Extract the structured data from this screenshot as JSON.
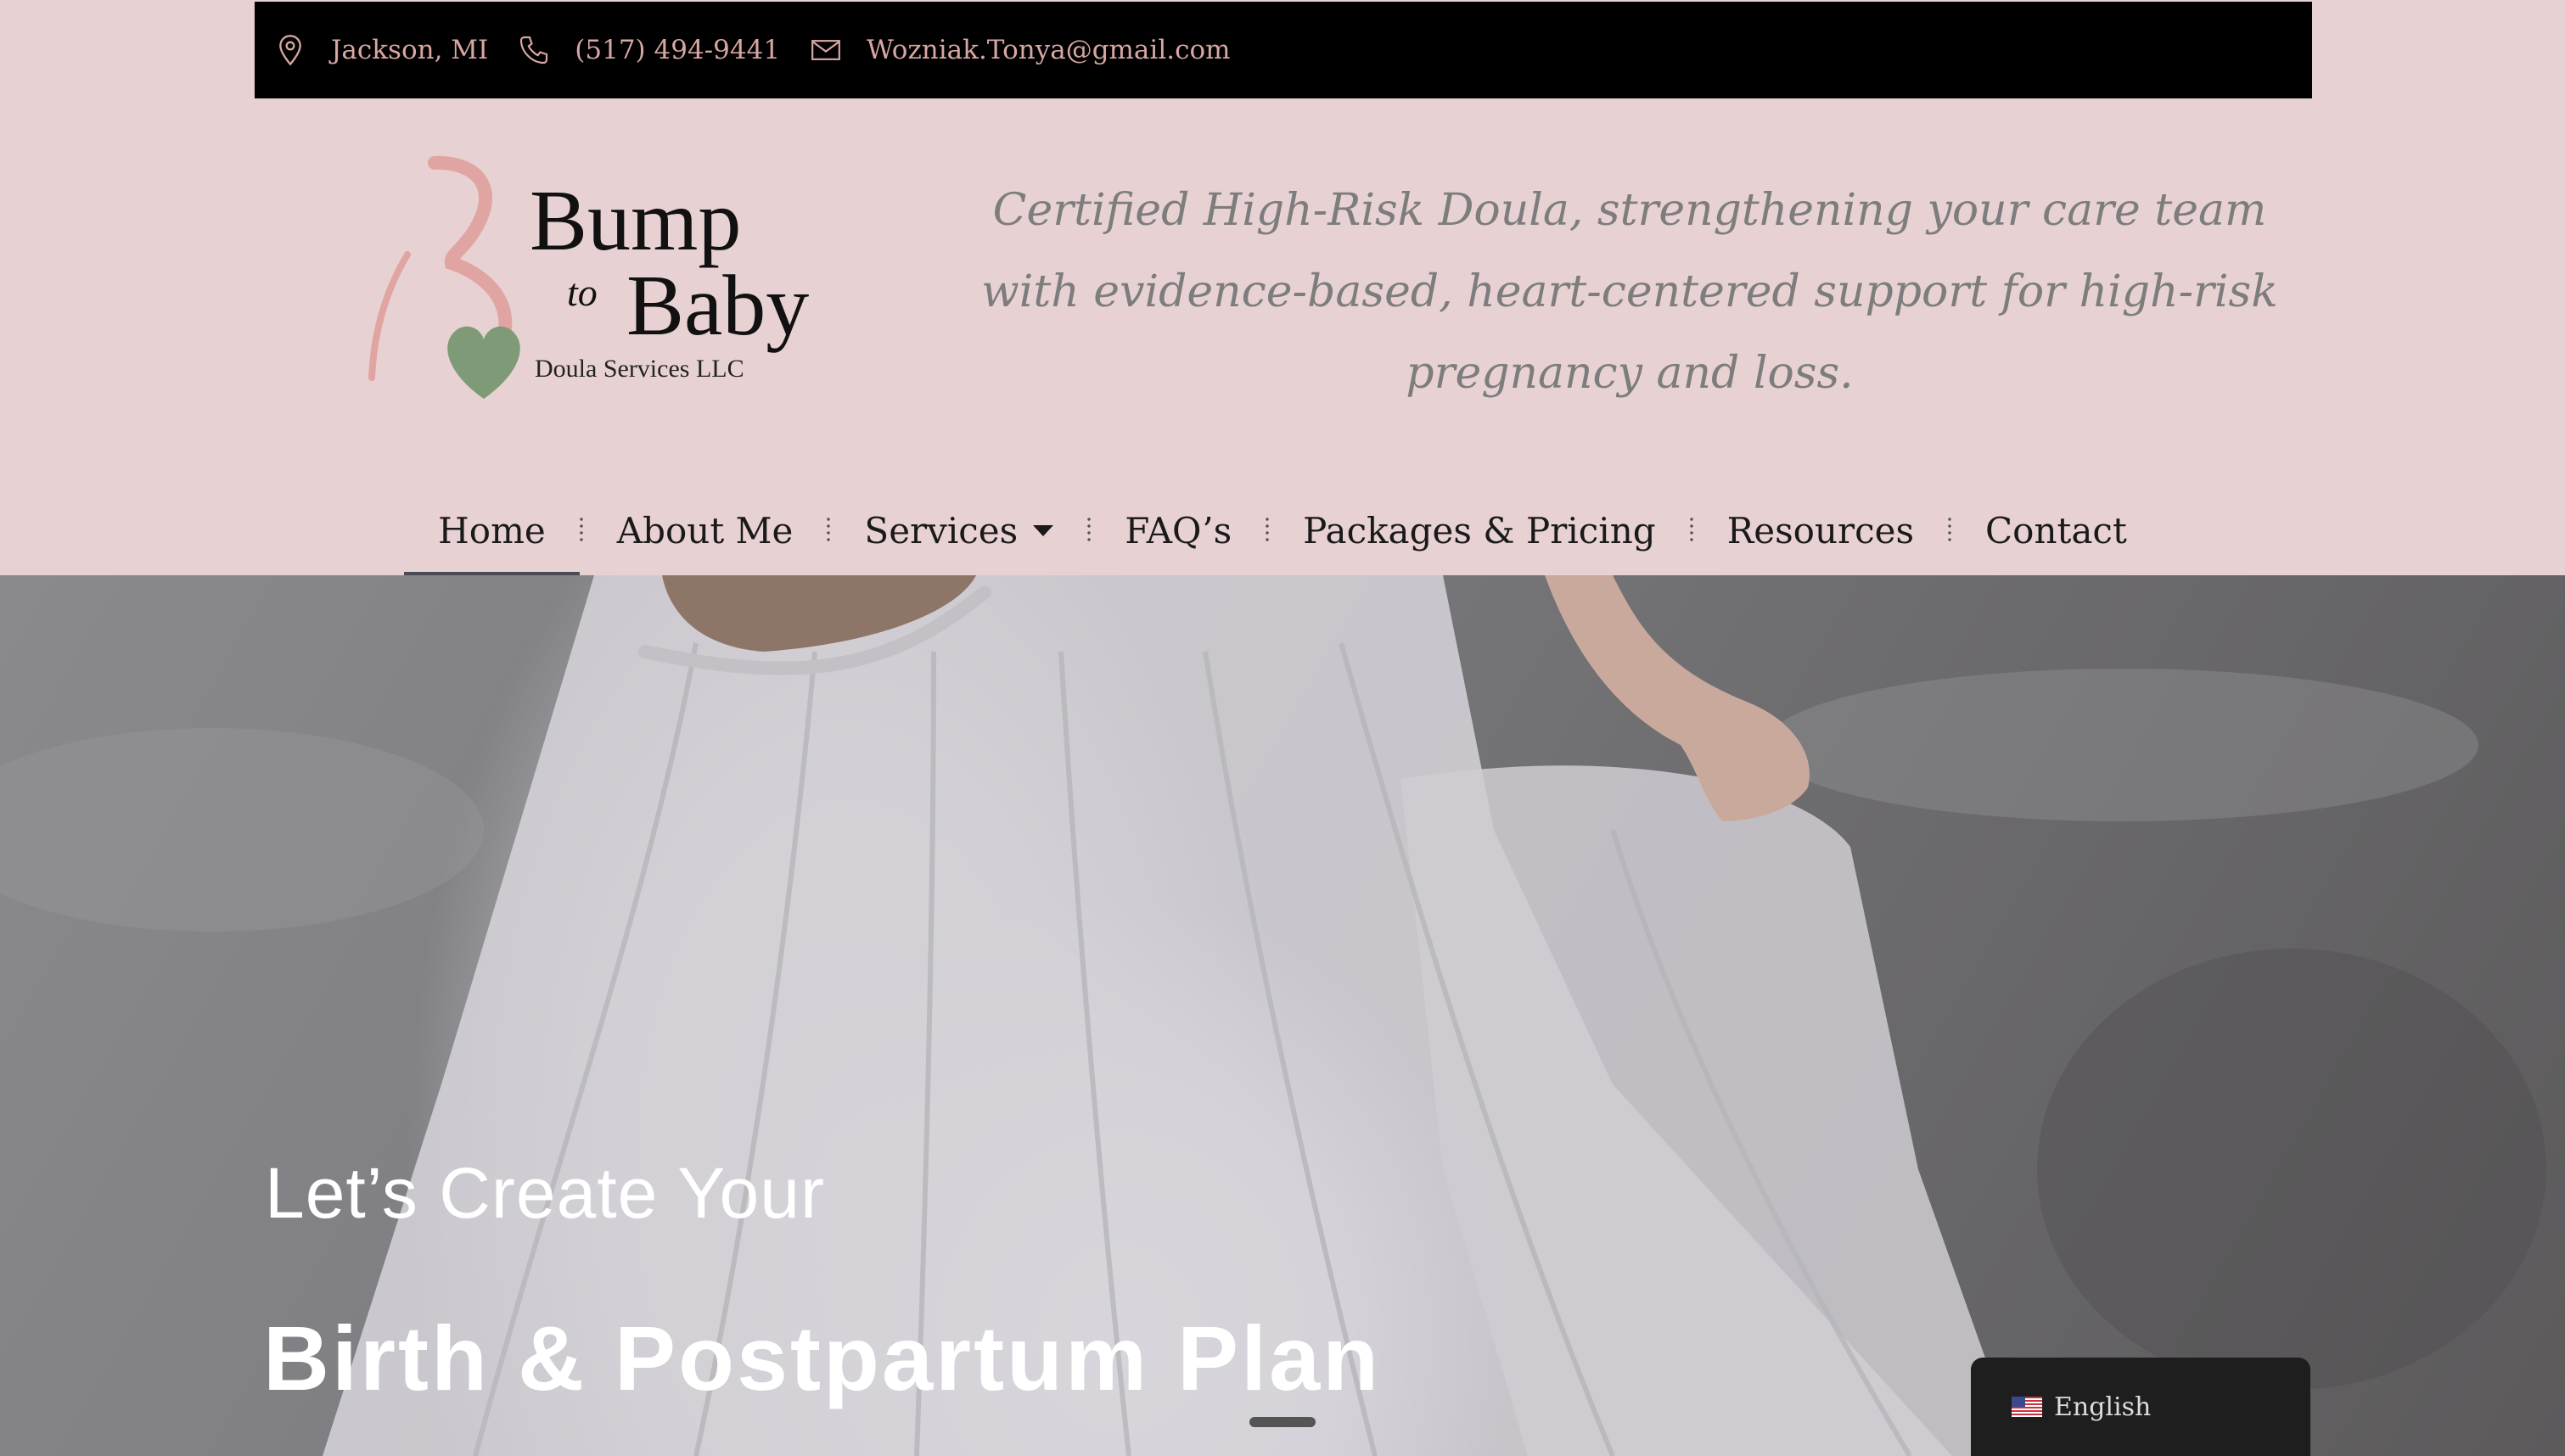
{
  "topbar": {
    "location": "Jackson, MI",
    "phone": "(517) 494-9441",
    "email": "Wozniak.Tonya@gmail.com"
  },
  "logo": {
    "line1": "Bump",
    "to": "to",
    "line2": "Baby",
    "subtitle": "Doula Services LLC"
  },
  "tagline": "Certified High-Risk Doula, strengthening your care team with evidence-based, heart-centered support for high-risk pregnancy and loss.",
  "nav": {
    "home": "Home",
    "about": "About Me",
    "services": "Services",
    "faq": "FAQ’s",
    "packages": "Packages & Pricing",
    "resources": "Resources",
    "contact": "Contact"
  },
  "hero": {
    "line1": "Let’s Create Your",
    "line2": "Birth & Postpartum Plan"
  },
  "language": {
    "label": "English",
    "flag_icon": "us-flag-icon"
  },
  "colors": {
    "page_bg": "#e8d1d2",
    "topbar_bg": "#000000",
    "topbar_text": "#d9a7a3",
    "logo_pink": "#e0a5a2",
    "logo_green": "#7f9a76",
    "tagline": "#7d7d7d"
  }
}
